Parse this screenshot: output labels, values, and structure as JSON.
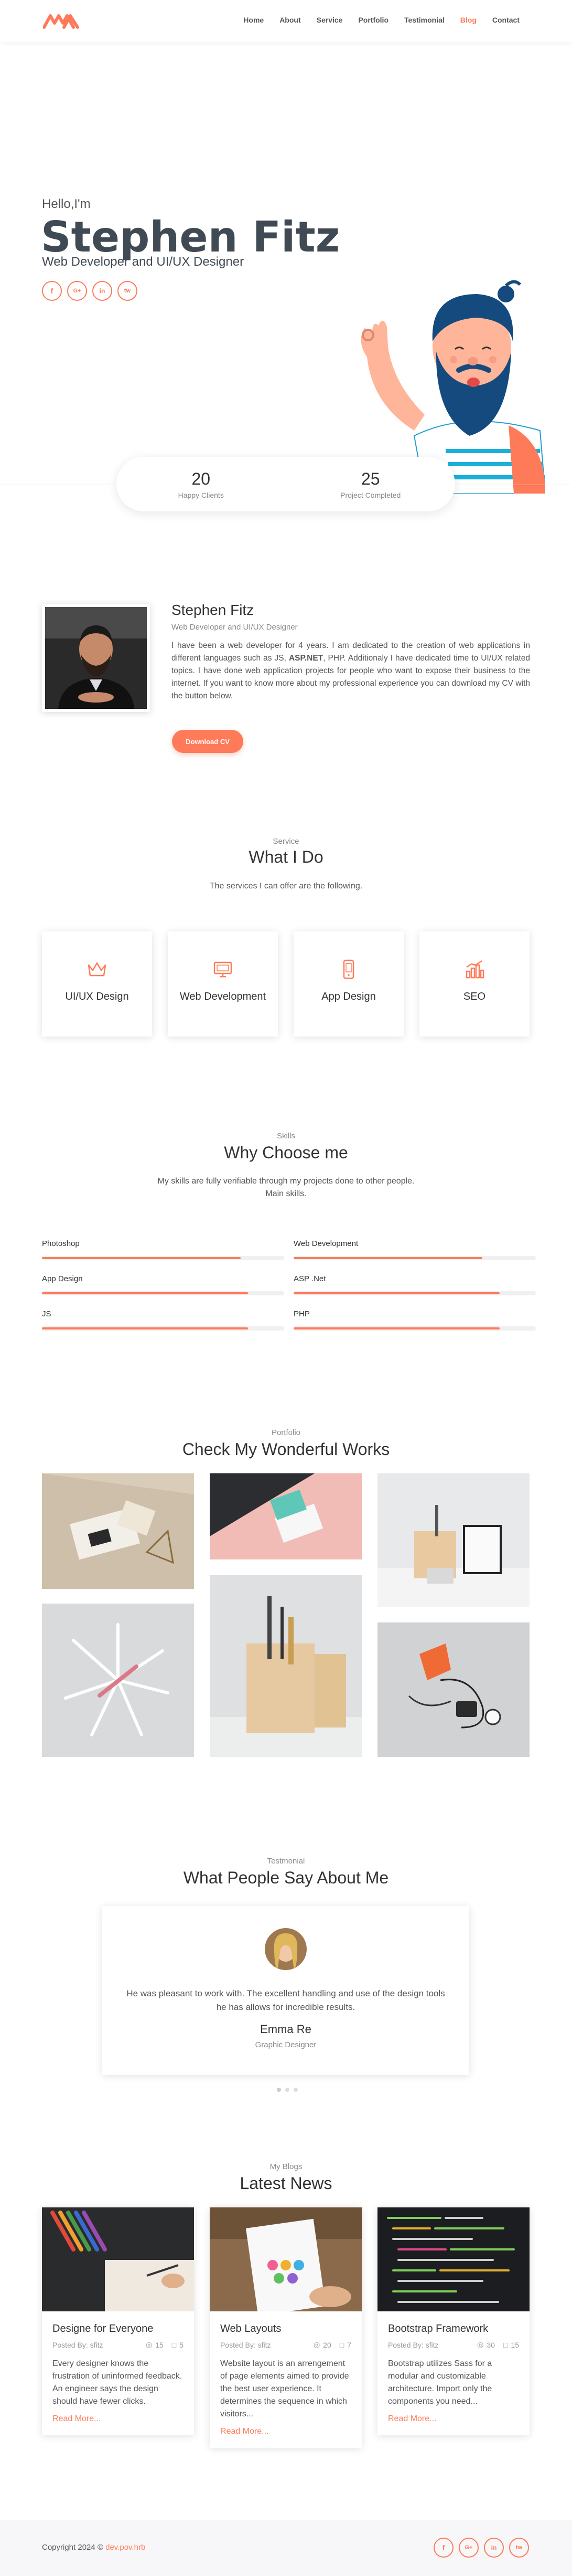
{
  "nav": {
    "items": [
      "Home",
      "About",
      "Service",
      "Portfolio",
      "Testimonial",
      "Blog",
      "Contact"
    ],
    "active": "Blog"
  },
  "hero": {
    "hello": "Hello,I'm",
    "name": "Stephen Fitz",
    "role": "Web Developer and UI/UX Designer",
    "socials": [
      "f",
      "G+",
      "in",
      "tw"
    ]
  },
  "stats": [
    {
      "num": "20",
      "label": "Happy Clients"
    },
    {
      "num": "25",
      "label": "Project Completed"
    }
  ],
  "about": {
    "name": "Stephen Fitz",
    "role": "Web Developer and UI/UX Designer",
    "text_before": "I have been a web developer for 4 years. I am dedicated to the creation of web applications in different languages such as JS, ",
    "text_bold": "ASP.NET",
    "text_after": ", PHP. Additionaly I have dedicated time to UI/UX related topics. I have done web application projects for people who want to expose their business to the internet. If you want to know more about my professional experience you can download my CV with the button below.",
    "button": "Download CV"
  },
  "services": {
    "tag": "Service",
    "title": "What I Do",
    "subtitle": "The services I can offer are the following.",
    "items": [
      {
        "label": "UI/UX Design",
        "icon": "crown-icon"
      },
      {
        "label": "Web Development",
        "icon": "monitor-icon"
      },
      {
        "label": "App Design",
        "icon": "phone-icon"
      },
      {
        "label": "SEO",
        "icon": "bar-chart-icon"
      }
    ]
  },
  "skills": {
    "tag": "Skills",
    "title": "Why Choose me",
    "subtitle_1": "My skills are fully verifiable through my projects done to other people.",
    "subtitle_2": "Main skills.",
    "items": [
      {
        "name": "Photoshop",
        "level": 0.82
      },
      {
        "name": "Web Development",
        "level": 0.78
      },
      {
        "name": "App Design",
        "level": 0.85
      },
      {
        "name": "ASP .Net",
        "level": 0.85
      },
      {
        "name": "JS",
        "level": 0.85
      },
      {
        "name": "PHP",
        "level": 0.85
      }
    ]
  },
  "portfolio": {
    "tag": "Portfolio",
    "title": "Check My Wonderful Works"
  },
  "testimonial": {
    "tag": "Testmonial",
    "title": "What People Say About Me",
    "quote": "He was pleasant to work with. The excellent handling and use of the design tools he has allows for incredible results.",
    "name": "Emma Re",
    "role": "Graphic Designer"
  },
  "blog": {
    "tag": "My Blogs",
    "title": "Latest News",
    "posts": [
      {
        "title": "Designe for Everyone",
        "author": "Posted By: sfitz",
        "views": "15",
        "comments": "5",
        "text": "Every designer knows the frustration of uninformed feedback. An engineer says the design should have fewer clicks.",
        "more": "Read More..."
      },
      {
        "title": "Web Layouts",
        "author": "Posted By: sfitz",
        "views": "20",
        "comments": "7",
        "text": "Website layout is an arrengement of page elements aimed to provide the best user experience. It determines the sequence in which visitors...",
        "more": "Read More..."
      },
      {
        "title": "Bootstrap Framework",
        "author": "Posted By: sfitz",
        "views": "30",
        "comments": "15",
        "text": "Bootstrap utilizes Sass for a modular and customizable architecture. Import only the components you need...",
        "more": "Read More..."
      }
    ]
  },
  "footer": {
    "copy_prefix": "Copyright 2024 © ",
    "copy_link": "dev.pov.hrb"
  },
  "colors": {
    "accent": "#ff7a59",
    "text": "#333333",
    "muted": "#888888"
  }
}
